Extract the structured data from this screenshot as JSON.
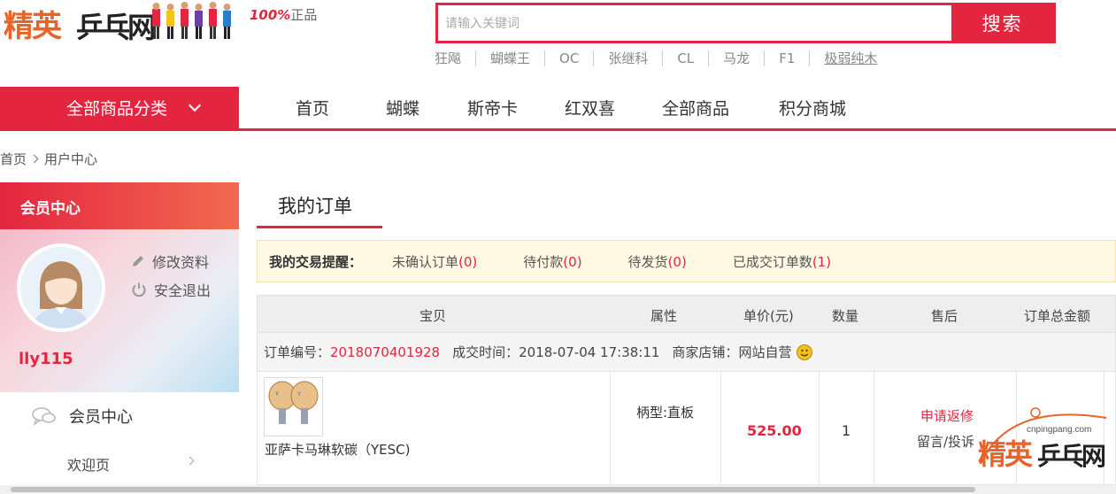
{
  "header": {
    "logo_part1": "精英",
    "logo_part2": "乒乓网",
    "badge_pct": "100%",
    "badge_text": "正品",
    "search_placeholder": "请输入关键词",
    "search_button": "搜索",
    "hotwords": [
      "狂飚",
      "蝴蝶王",
      "OC",
      "张继科",
      "CL",
      "马龙",
      "F1",
      "极弱纯木"
    ]
  },
  "nav": {
    "category_label": "全部商品分类",
    "items": [
      "首页",
      "蝴蝶",
      "斯帝卡",
      "红双喜",
      "全部商品",
      "积分商城"
    ]
  },
  "breadcrumb": [
    "首页",
    "用户中心"
  ],
  "sidebar": {
    "head": "会员中心",
    "edit_profile": "修改资料",
    "logout": "安全退出",
    "username": "lly115",
    "menu_main": "会员中心",
    "menu_sub": "欢迎页"
  },
  "main": {
    "title": "我的订单",
    "reminder": {
      "label": "我的交易提醒：",
      "items": [
        {
          "label": "未确认订单",
          "count": "(0)"
        },
        {
          "label": "待付款",
          "count": "(0)"
        },
        {
          "label": "待发货",
          "count": "(0)"
        },
        {
          "label": "已成交订单数",
          "count": "(1)"
        }
      ]
    },
    "table_headers": [
      "宝贝",
      "属性",
      "单价(元)",
      "数量",
      "售后",
      "订单总金额"
    ],
    "order": {
      "no_label": "订单编号：",
      "no": "2018070401928",
      "time_label": "成交时间：",
      "time": "2018-07-04 17:38:11",
      "shop_label": "商家店铺：",
      "shop": "网站自营",
      "item_name": "亚萨卡马琳软碳（YESC)",
      "attr": "柄型:直板",
      "price": "525.00",
      "qty": "1",
      "after_sale_apply": "申请返修",
      "after_sale_comment": "留言/投诉"
    }
  },
  "watermark": {
    "url": "cnpingpang.com",
    "part1": "精英",
    "part2": "乒乓网"
  },
  "colors": {
    "accent": "#e4253f",
    "reminder_bg": "#fff9e3"
  }
}
